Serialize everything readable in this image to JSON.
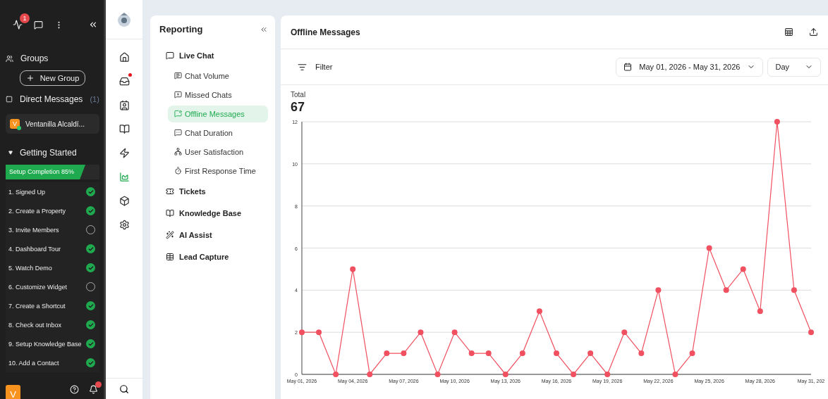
{
  "sidebar": {
    "notification_count": "1",
    "groups_label": "Groups",
    "new_group_button": "New Group",
    "direct_messages": {
      "label": "Direct Messages",
      "count": "(1)"
    },
    "contacts": [
      {
        "initial": "V",
        "name": "Ventanilla Alcaldí...",
        "online": true
      }
    ],
    "getting_started": {
      "title": "Getting Started",
      "expanded": true,
      "progress": {
        "label": "Setup Completion 85%",
        "level": 0.85
      },
      "steps": [
        {
          "label": "1. Signed Up",
          "done": true
        },
        {
          "label": "2. Create a Property",
          "done": true
        },
        {
          "label": "3. Invite Members",
          "done": false
        },
        {
          "label": "4. Dashboard Tour",
          "done": true
        },
        {
          "label": "5. Watch Demo",
          "done": true
        },
        {
          "label": "6. Customize Widget",
          "done": false
        },
        {
          "label": "7. Create a Shortcut",
          "done": true
        },
        {
          "label": "8. Check out Inbox",
          "done": true
        },
        {
          "label": "9. Setup Knowledge Base",
          "done": true
        },
        {
          "label": "10. Add a Contact",
          "done": true
        }
      ]
    },
    "footer": {
      "avatar": "V"
    }
  },
  "rail": {
    "items": [
      {
        "selected": false,
        "badge": false
      },
      {
        "selected": false,
        "badge": true
      },
      {
        "selected": false,
        "badge": false
      },
      {
        "selected": false,
        "badge": false
      },
      {
        "selected": false,
        "badge": false
      },
      {
        "selected": true,
        "badge": false
      },
      {
        "selected": false,
        "badge": false
      },
      {
        "selected": false,
        "badge": false
      }
    ]
  },
  "reporting": {
    "title": "Reporting",
    "groups": [
      {
        "label": "Live Chat",
        "children": [
          {
            "label": "Chat Volume",
            "selected": false
          },
          {
            "label": "Missed Chats",
            "selected": false
          },
          {
            "label": "Offline Messages",
            "selected": true
          },
          {
            "label": "Chat Duration",
            "selected": false
          },
          {
            "label": "User Satisfaction",
            "selected": false
          },
          {
            "label": "First Response Time",
            "selected": false
          }
        ]
      },
      {
        "label": "Tickets"
      },
      {
        "label": "Knowledge Base"
      },
      {
        "label": "AI Assist"
      },
      {
        "label": "Lead Capture"
      }
    ]
  },
  "report": {
    "title": "Offline Messages",
    "filter": "Filter",
    "date_range": "May 01, 2026 - May 31, 2026",
    "interval": "Day",
    "total_label": "Total",
    "total": "67",
    "chart_data": {
      "type": "line",
      "categories": [
        "May 01, 2026",
        null,
        null,
        "May 04, 2026",
        null,
        null,
        "May 07, 2026",
        null,
        null,
        "May 10, 2026",
        null,
        null,
        "May 13, 2026",
        null,
        null,
        "May 16, 2026",
        null,
        null,
        "May 19, 2026",
        null,
        null,
        "May 22, 2026",
        null,
        null,
        "May 25, 2026",
        null,
        null,
        "May 28, 2026",
        null,
        null,
        "May 31, 202"
      ],
      "series": [
        {
          "color": "#f0505f",
          "marker": "circle",
          "values": [
            2,
            2,
            0,
            5,
            0,
            1,
            1,
            2,
            0,
            2,
            1,
            1,
            0,
            1,
            3,
            1,
            0,
            1,
            0,
            2,
            1,
            4,
            0,
            1,
            6,
            4,
            5,
            3,
            12,
            4,
            2
          ]
        }
      ],
      "grid": true,
      "ylim": [
        0,
        12
      ],
      "yticks": [
        0,
        2,
        4,
        6,
        8,
        10,
        12
      ]
    }
  }
}
